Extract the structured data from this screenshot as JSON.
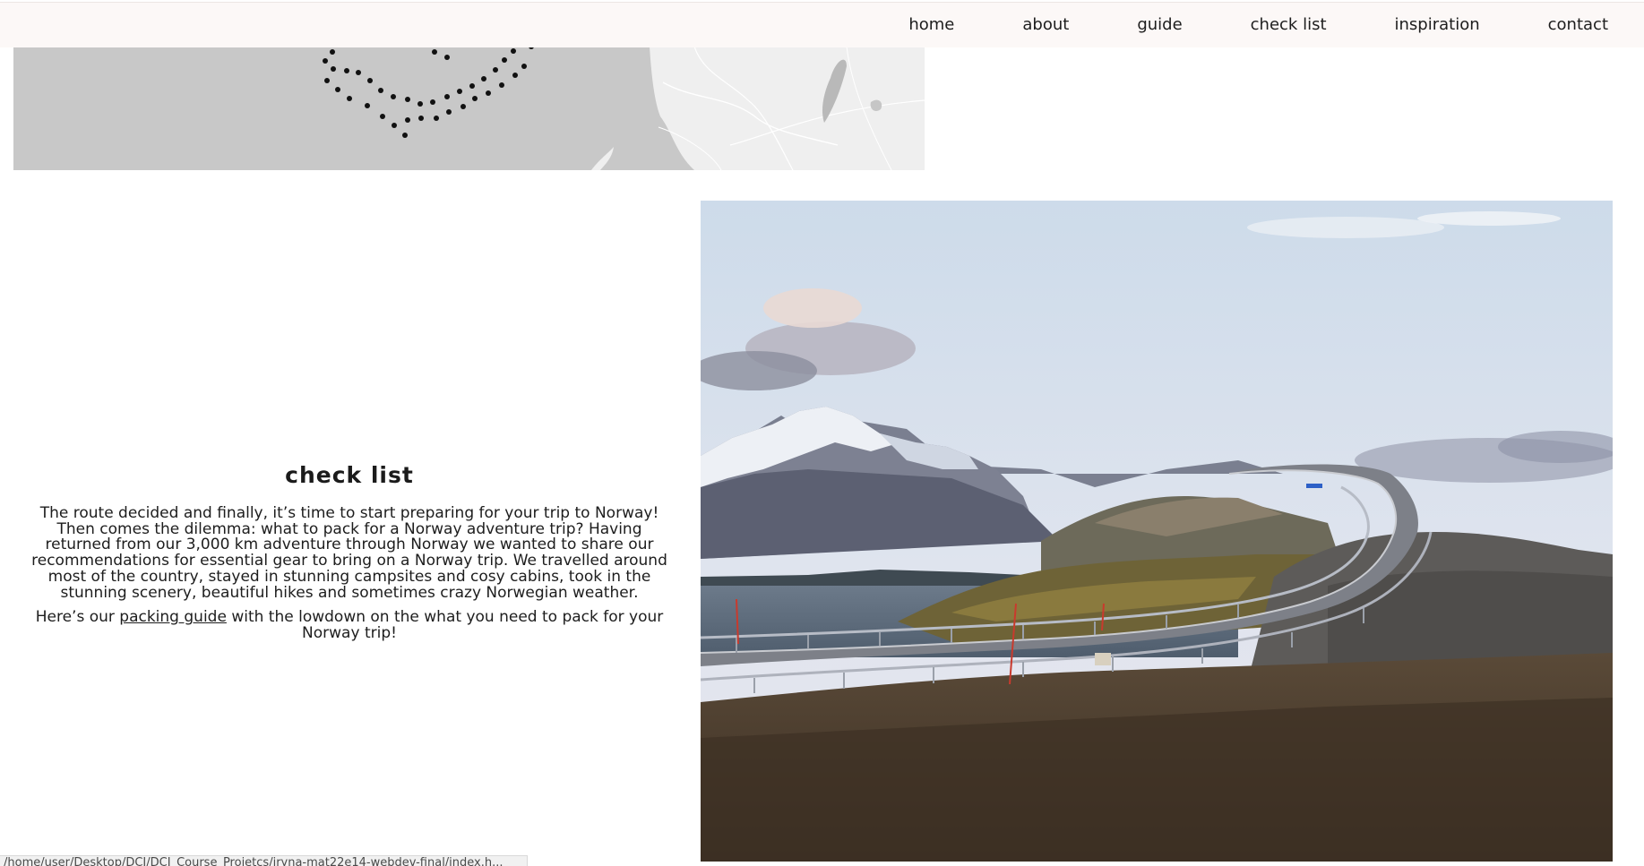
{
  "nav": {
    "items": [
      {
        "label": "home"
      },
      {
        "label": "about"
      },
      {
        "label": "guide"
      },
      {
        "label": "check list"
      },
      {
        "label": "inspiration"
      },
      {
        "label": "contact"
      }
    ]
  },
  "section": {
    "title": "check list",
    "paragraph1": "The route decided and finally, it’s time to start preparing for your trip to Norway! Then comes the dilemma: what to pack for a Norway adventure trip? Having returned from our 3,000 km adventure through Norway we wanted to share our recommendations for essential gear to bring on a Norway trip. We travelled around most of the country, stayed in stunning campsites and cosy cabins, took in the stunning scenery, beautiful hikes and sometimes crazy Norwegian weather.",
    "paragraph2_before": "Here’s our ",
    "paragraph2_link": "packing guide",
    "paragraph2_after": " with the lowdown on the what you need to pack for your Norway trip!"
  },
  "status": {
    "url": "/home/user/Desktop/DCI/DCI_Course_Projetcs/iryna-mat22e14-webdev-final/index.h..."
  },
  "colors": {
    "topbar_bg": "#fcf8f7",
    "text": "#1d1d1d",
    "map_bg": "#c9c9c9",
    "sky": "#d3dfec"
  }
}
